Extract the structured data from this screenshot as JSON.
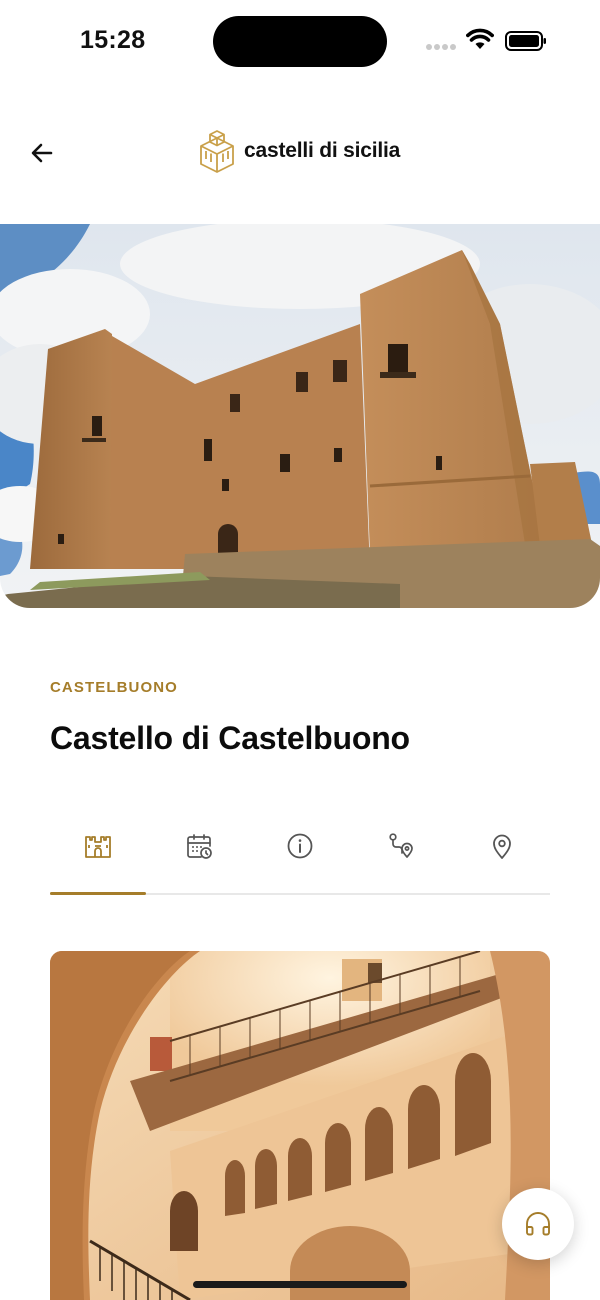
{
  "status_bar": {
    "time": "15:28"
  },
  "header": {
    "brand_name": "castelli di sicilia",
    "back_icon": "arrow-left-icon",
    "logo_icon": "castle-cube-logo"
  },
  "castle": {
    "location": "CASTELBUONO",
    "name": "Castello di Castelbuono"
  },
  "tabs": [
    {
      "icon": "castle-icon",
      "active": true
    },
    {
      "icon": "calendar-clock-icon",
      "active": false
    },
    {
      "icon": "info-icon",
      "active": false
    },
    {
      "icon": "route-icon",
      "active": false
    },
    {
      "icon": "map-pin-icon",
      "active": false
    }
  ],
  "audio_guide": {
    "icon": "headphones-icon"
  },
  "colors": {
    "accent": "#a57d2a",
    "icon_gray": "#555555",
    "text": "#0c0c0c"
  }
}
